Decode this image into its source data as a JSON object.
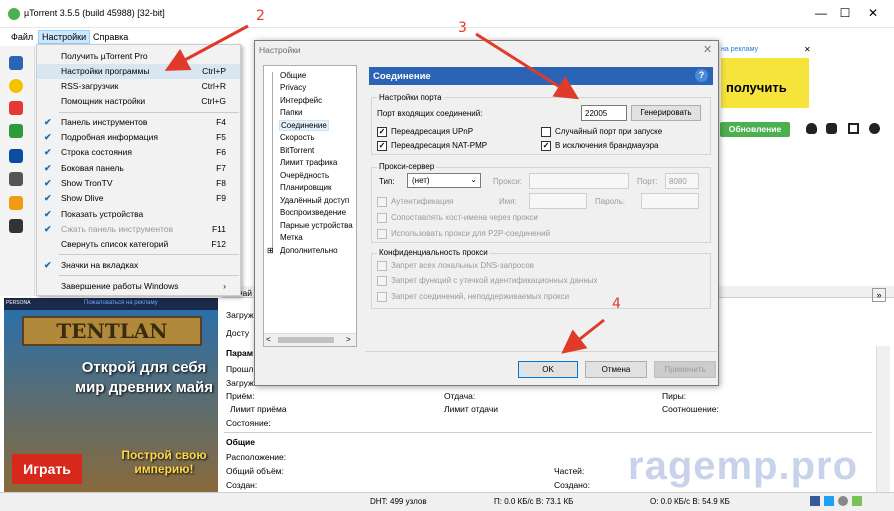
{
  "window": {
    "title": "µTorrent 3.5.5  (build 45988) [32-bit]",
    "minimize": "—",
    "maximize": "☐",
    "close": "✕"
  },
  "menubar": {
    "items": [
      "Файл",
      "Настройки",
      "Справка"
    ]
  },
  "settings_menu": {
    "items": [
      {
        "label": "Получить µTorrent Pro",
        "shortcut": "",
        "checked": false
      },
      {
        "label": "Настройки программы",
        "shortcut": "Ctrl+P",
        "checked": false
      },
      {
        "label": "RSS-загрузчик",
        "shortcut": "Ctrl+R",
        "checked": false
      },
      {
        "label": "Помощник настройки",
        "shortcut": "Ctrl+G",
        "checked": false
      },
      {
        "label": "Панель инструментов",
        "shortcut": "F4",
        "checked": true
      },
      {
        "label": "Подробная информация",
        "shortcut": "F5",
        "checked": true
      },
      {
        "label": "Строка состояния",
        "shortcut": "F6",
        "checked": true
      },
      {
        "label": "Боковая панель",
        "shortcut": "F7",
        "checked": true
      },
      {
        "label": "Show TronTV",
        "shortcut": "F8",
        "checked": true
      },
      {
        "label": "Show Dlive",
        "shortcut": "F9",
        "checked": true
      },
      {
        "label": "Показать устройства",
        "shortcut": "",
        "checked": true
      },
      {
        "label": "Сжать панель инструментов",
        "shortcut": "F11",
        "checked": true
      },
      {
        "label": "Свернуть список категорий",
        "shortcut": "F12",
        "checked": false
      },
      {
        "label": "Значки на вкладках",
        "shortcut": "",
        "checked": true
      },
      {
        "label": "Завершение работы Windows",
        "shortcut": "›",
        "checked": false
      }
    ]
  },
  "top_ad": {
    "tag": "на рекламу",
    "cta": "получить",
    "close": "✕"
  },
  "toolbar": {
    "update_label": "Обновление"
  },
  "left_ad": {
    "brand": "PERSONA",
    "tag": "Пожаловаться на рекламу",
    "logo": "TENTLAN",
    "promo": "Открой для себя мир древних майя",
    "play": "Играть",
    "promo2": "Построй свою империю!"
  },
  "dialog": {
    "title": "Настройки",
    "close": "✕",
    "tree": [
      "Общие",
      "Privacy",
      "Интерфейс",
      "Папки",
      "Соединение",
      "Скорость",
      "BitTorrent",
      "Лимит трафика",
      "Очерёдность",
      "Планировщик",
      "Удалённый доступ",
      "Воспроизведение",
      "Парные устройства",
      "Метка",
      "Дополнительно"
    ],
    "tree_scroll_left": "<",
    "tree_scroll_right": ">",
    "panel_title": "Соединение",
    "help": "?",
    "port": {
      "group": "Настройки порта",
      "label": "Порт входящих соединений:",
      "value": "22005",
      "generate": "Генерировать",
      "upnp": "Переадресация UPnP",
      "natpmp": "Переадресация NAT-PMP",
      "random": "Случайный порт при запуске",
      "firewall": "В исключения брандмауэра"
    },
    "proxy": {
      "group": "Прокси-сервер",
      "type_label": "Тип:",
      "type_value": "(нет)",
      "proxy_label": "Прокси:",
      "port_label": "Порт:",
      "port_value": "8080",
      "auth": "Аутентификация",
      "name_label": "Имя:",
      "pass_label": "Пароль:",
      "resolve": "Сопоставлять хост-имена через прокси",
      "p2p": "Использовать прокси для P2P-соединений"
    },
    "privacy": {
      "group": "Конфиденциальность прокси",
      "dns": "Запрет всех локальных DNS-запросов",
      "leak": "Запрет функций с утечкой идентификационных данных",
      "unsupported": "Запрет соединений, неподдерживаемых прокси"
    },
    "buttons": {
      "ok": "OK",
      "cancel": "Отмена",
      "apply": "Применить"
    }
  },
  "detail": {
    "tab_files": "Фай",
    "loaded": "Загруж",
    "available": "Досту",
    "params": "Парам",
    "elapsed": "Прошл",
    "loaded2": "Загруж",
    "reception": "Приём:",
    "sending": "Отдача:",
    "peers": "Пиры:",
    "recv_limit": "Лимит приёма",
    "send_limit": "Лимит отдачи",
    "ratio": "Соотношение:",
    "state": "Состояние:",
    "general": "Общие",
    "location": "Расположение:",
    "total": "Общий объём:",
    "parts": "Частей:",
    "created": "Создан:",
    "created2": "Создано:"
  },
  "statusbar": {
    "dht": "DHT: 499 узлов",
    "down": "П: 0.0 КБ/с В: 73.1 КБ",
    "up": "О: 0.0 КБ/с В: 54.9 КБ"
  },
  "watermark": "ragemp.pro",
  "annotations": [
    "2",
    "3",
    "4"
  ],
  "colors": {
    "accent": "#2b63b5",
    "update": "#4caf50",
    "arrow": "#e03a2a"
  }
}
